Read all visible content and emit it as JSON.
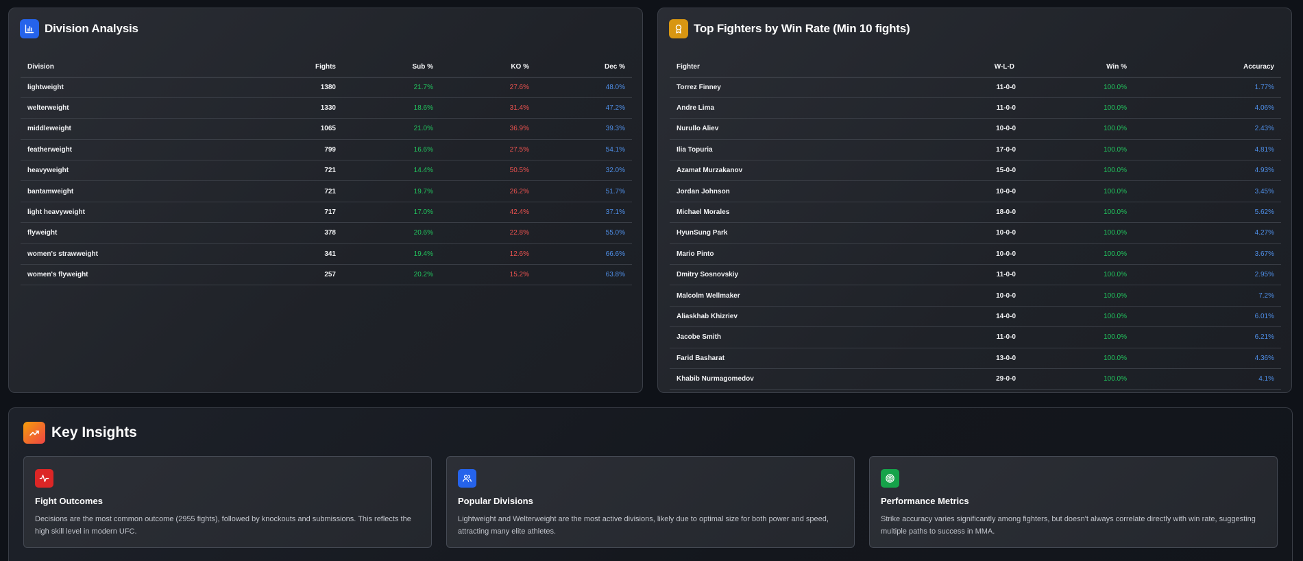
{
  "division": {
    "title": "Division Analysis",
    "icon": "bar-chart-icon",
    "headers": [
      "Division",
      "Fights",
      "Sub %",
      "KO %",
      "Dec %"
    ],
    "rows": [
      {
        "division": "lightweight",
        "fights": "1380",
        "sub": "21.7%",
        "ko": "27.6%",
        "dec": "48.0%"
      },
      {
        "division": "welterweight",
        "fights": "1330",
        "sub": "18.6%",
        "ko": "31.4%",
        "dec": "47.2%"
      },
      {
        "division": "middleweight",
        "fights": "1065",
        "sub": "21.0%",
        "ko": "36.9%",
        "dec": "39.3%"
      },
      {
        "division": "featherweight",
        "fights": "799",
        "sub": "16.6%",
        "ko": "27.5%",
        "dec": "54.1%"
      },
      {
        "division": "heavyweight",
        "fights": "721",
        "sub": "14.4%",
        "ko": "50.5%",
        "dec": "32.0%"
      },
      {
        "division": "bantamweight",
        "fights": "721",
        "sub": "19.7%",
        "ko": "26.2%",
        "dec": "51.7%"
      },
      {
        "division": "light heavyweight",
        "fights": "717",
        "sub": "17.0%",
        "ko": "42.4%",
        "dec": "37.1%"
      },
      {
        "division": "flyweight",
        "fights": "378",
        "sub": "20.6%",
        "ko": "22.8%",
        "dec": "55.0%"
      },
      {
        "division": "women's strawweight",
        "fights": "341",
        "sub": "19.4%",
        "ko": "12.6%",
        "dec": "66.6%"
      },
      {
        "division": "women's flyweight",
        "fights": "257",
        "sub": "20.2%",
        "ko": "15.2%",
        "dec": "63.8%"
      }
    ]
  },
  "fighters": {
    "title": "Top Fighters by Win Rate (Min 10 fights)",
    "icon": "award-icon",
    "headers": [
      "Fighter",
      "W-L-D",
      "Win %",
      "Accuracy"
    ],
    "rows": [
      {
        "name": "Torrez Finney",
        "wld": "11-0-0",
        "win": "100.0%",
        "acc": "1.77%"
      },
      {
        "name": "Andre Lima",
        "wld": "11-0-0",
        "win": "100.0%",
        "acc": "4.06%"
      },
      {
        "name": "Nurullo Aliev",
        "wld": "10-0-0",
        "win": "100.0%",
        "acc": "2.43%"
      },
      {
        "name": "Ilia Topuria",
        "wld": "17-0-0",
        "win": "100.0%",
        "acc": "4.81%"
      },
      {
        "name": "Azamat Murzakanov",
        "wld": "15-0-0",
        "win": "100.0%",
        "acc": "4.93%"
      },
      {
        "name": "Jordan Johnson",
        "wld": "10-0-0",
        "win": "100.0%",
        "acc": "3.45%"
      },
      {
        "name": "Michael Morales",
        "wld": "18-0-0",
        "win": "100.0%",
        "acc": "5.62%"
      },
      {
        "name": "HyunSung Park",
        "wld": "10-0-0",
        "win": "100.0%",
        "acc": "4.27%"
      },
      {
        "name": "Mario Pinto",
        "wld": "10-0-0",
        "win": "100.0%",
        "acc": "3.67%"
      },
      {
        "name": "Dmitry Sosnovskiy",
        "wld": "11-0-0",
        "win": "100.0%",
        "acc": "2.95%"
      },
      {
        "name": "Malcolm Wellmaker",
        "wld": "10-0-0",
        "win": "100.0%",
        "acc": "7.2%"
      },
      {
        "name": "Aliaskhab Khizriev",
        "wld": "14-0-0",
        "win": "100.0%",
        "acc": "6.01%"
      },
      {
        "name": "Jacobe Smith",
        "wld": "11-0-0",
        "win": "100.0%",
        "acc": "6.21%"
      },
      {
        "name": "Farid Basharat",
        "wld": "13-0-0",
        "win": "100.0%",
        "acc": "4.36%"
      },
      {
        "name": "Khabib Nurmagomedov",
        "wld": "29-0-0",
        "win": "100.0%",
        "acc": "4.1%"
      }
    ]
  },
  "insights": {
    "title": "Key Insights",
    "icon": "trending-up-icon",
    "cards": [
      {
        "icon": "activity-icon",
        "color": "#dc2626",
        "title": "Fight Outcomes",
        "text": "Decisions are the most common outcome (2955 fights), followed by knockouts and submissions. This reflects the high skill level in modern UFC."
      },
      {
        "icon": "users-icon",
        "color": "#2563eb",
        "title": "Popular Divisions",
        "text": "Lightweight and Welterweight are the most active divisions, likely due to optimal size for both power and speed, attracting many elite athletes."
      },
      {
        "icon": "target-icon",
        "color": "#16a34a",
        "title": "Performance Metrics",
        "text": "Strike accuracy varies significantly among fighters, but doesn't always correlate directly with win rate, suggesting multiple paths to success in MMA."
      }
    ]
  },
  "colors": {
    "positive": "#22c55e",
    "negative": "#ef5350",
    "accent": "#4f8fe8"
  }
}
